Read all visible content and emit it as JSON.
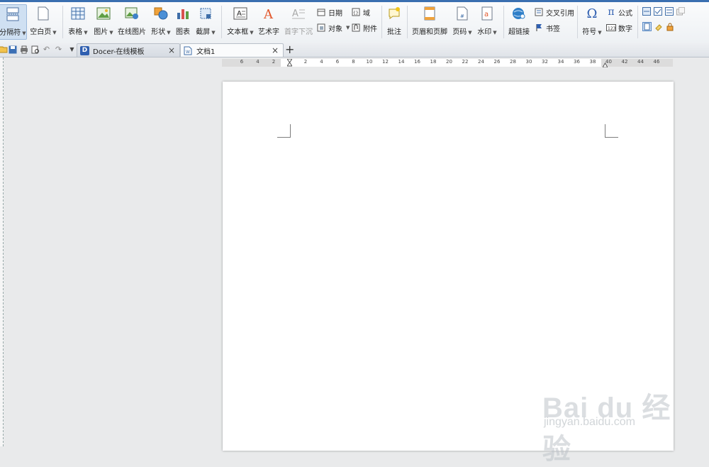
{
  "ribbon": {
    "separator_button": "分隔符",
    "blank_page": "空白页",
    "table": "表格",
    "picture": "图片",
    "online_picture": "在线图片",
    "shape": "形状",
    "chart": "图表",
    "screenshot": "截屏",
    "text_box": "文本框",
    "word_art": "艺术字",
    "drop_cap": "首字下沉",
    "date": "日期",
    "object": "对象",
    "field": "域",
    "attachment": "附件",
    "comment": "批注",
    "header_footer": "页眉和页脚",
    "page_number": "页码",
    "watermark": "水印",
    "hyperlink": "超链接",
    "cross_ref": "交叉引用",
    "bookmark": "书签",
    "symbol": "符号",
    "formula": "公式",
    "number": "数字"
  },
  "tabs": {
    "docer": "Docer-在线模板",
    "doc1": "文档1",
    "new_tab": "+"
  },
  "ruler": {
    "labels": [
      "6",
      "4",
      "2",
      "",
      "2",
      "4",
      "6",
      "8",
      "10",
      "12",
      "14",
      "16",
      "18",
      "20",
      "22",
      "24",
      "26",
      "28",
      "30",
      "32",
      "34",
      "36",
      "38",
      "40",
      "42",
      "44",
      "46"
    ]
  },
  "watermark": {
    "brand": "Bai du 经验",
    "url": "jingyan.baidu.com"
  },
  "colors": {
    "accent": "#3a6fb0",
    "active_button": "#cfe0f2"
  }
}
